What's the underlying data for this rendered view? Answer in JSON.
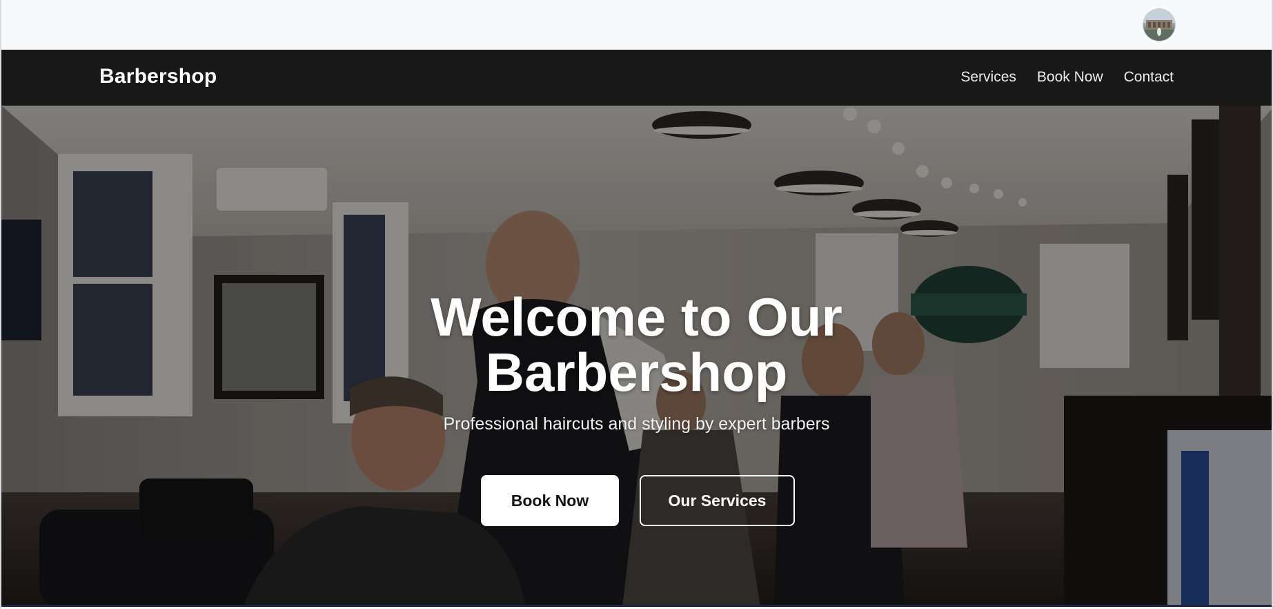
{
  "user": {
    "avatar_icon": "user-avatar-photo"
  },
  "nav": {
    "brand": "Barbershop",
    "links": [
      "Services",
      "Book Now",
      "Contact"
    ]
  },
  "hero": {
    "title_line1": "Welcome to Our",
    "title_line2": "Barbershop",
    "subtitle": "Professional haircuts and styling by expert barbers",
    "primary_button": "Book Now",
    "secondary_button": "Our Services"
  },
  "colors": {
    "navbar_bg": "#181818",
    "page_bg": "#f8f9fb",
    "primary_button_bg": "#ffffff",
    "text_light": "#ffffff"
  }
}
